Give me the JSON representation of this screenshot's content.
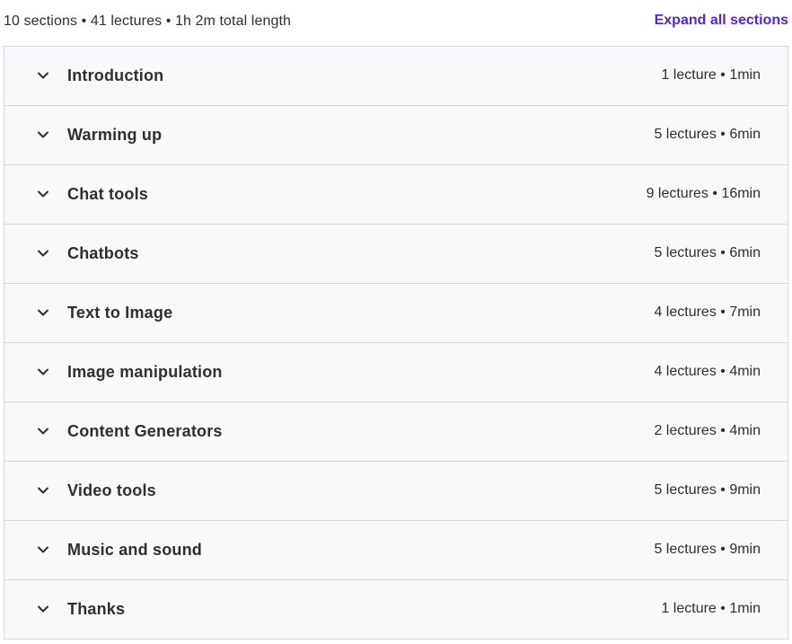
{
  "header": {
    "summary": "10 sections • 41 lectures • 1h 2m total length",
    "expand_label": "Expand all sections"
  },
  "sections": [
    {
      "title": "Introduction",
      "meta": "1 lecture • 1min"
    },
    {
      "title": "Warming up",
      "meta": "5 lectures • 6min"
    },
    {
      "title": "Chat tools",
      "meta": "9 lectures • 16min"
    },
    {
      "title": "Chatbots",
      "meta": "5 lectures • 6min"
    },
    {
      "title": "Text to Image",
      "meta": "4 lectures • 7min"
    },
    {
      "title": "Image manipulation",
      "meta": "4 lectures • 4min"
    },
    {
      "title": "Content Generators",
      "meta": "2 lectures • 4min"
    },
    {
      "title": "Video tools",
      "meta": "5 lectures • 9min"
    },
    {
      "title": "Music and sound",
      "meta": "5 lectures • 9min"
    },
    {
      "title": "Thanks",
      "meta": "1 lecture • 1min"
    }
  ],
  "icons": {
    "chevron": "chevron-down-icon"
  },
  "colors": {
    "accent": "#5624d0",
    "row_background": "#f7f9fa",
    "border": "#d1d7dc",
    "text": "#2d2f31"
  }
}
